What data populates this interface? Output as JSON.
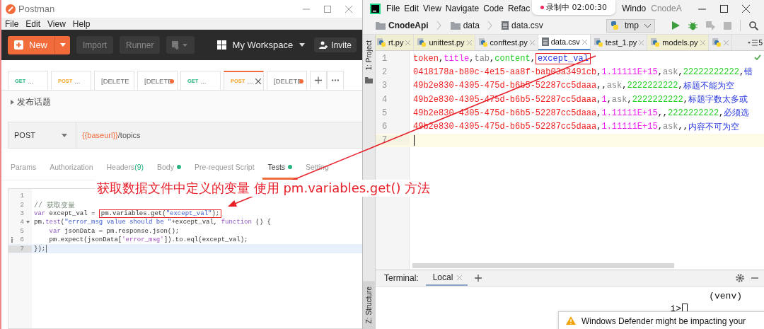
{
  "postman": {
    "title": "Postman",
    "menu": [
      "File",
      "Edit",
      "View",
      "Help"
    ],
    "toolbar": {
      "new_label": "New",
      "import_label": "Import",
      "runner_label": "Runner",
      "workspace": "My Workspace",
      "invite": "Invite"
    },
    "tabs": [
      {
        "method": "GET",
        "kind": "get",
        "label": "...",
        "unsaved": false,
        "selected": false
      },
      {
        "method": "POST",
        "kind": "post",
        "label": "...",
        "unsaved": false,
        "selected": false
      },
      {
        "kind": "plain",
        "label": "[DELETE",
        "unsaved": false,
        "selected": false
      },
      {
        "kind": "plain",
        "label": "[DELETE",
        "unsaved": true,
        "selected": false
      },
      {
        "method": "GET",
        "kind": "get",
        "label": "...",
        "unsaved": false,
        "selected": false
      },
      {
        "method": "POST",
        "kind": "post",
        "label": "...",
        "unsaved": false,
        "selected": true
      },
      {
        "kind": "plain",
        "label": "[DELETE",
        "unsaved": true,
        "selected": false
      }
    ],
    "collection": "发布话题",
    "request": {
      "method": "POST",
      "url_variable": "{{baseurl}}",
      "url_path": "/topics"
    },
    "request_tabs": [
      {
        "label": "Params",
        "dot": false,
        "selected": false
      },
      {
        "label": "Authorization",
        "dot": false,
        "selected": false
      },
      {
        "label": "Headers",
        "count": "(9)",
        "dot": false,
        "selected": false
      },
      {
        "label": "Body",
        "dot": true,
        "selected": false
      },
      {
        "label": "Pre-request Script",
        "dot": false,
        "selected": false
      },
      {
        "label": "Tests",
        "dot": true,
        "selected": true
      },
      {
        "label": "Setting",
        "dot": false,
        "selected": false
      }
    ],
    "code_lines": [
      {
        "number": "1",
        "fold": false,
        "info": false,
        "current": false
      },
      {
        "number": "2",
        "fold": false,
        "info": false,
        "current": false,
        "tokens": [
          {
            "text": "// 获取变量",
            "kind": "comment"
          }
        ]
      },
      {
        "number": "3",
        "fold": false,
        "info": false,
        "current": false,
        "tokens": [
          {
            "text": "var",
            "kind": "keyword"
          },
          {
            "text": " except_val = ",
            "kind": "plain"
          },
          {
            "kind": "box",
            "tokens": [
              {
                "text": "pm.variables.get(",
                "kind": "plain"
              },
              {
                "text": "\"except_val\"",
                "kind": "string"
              },
              {
                "text": ");",
                "kind": "plain"
              }
            ]
          }
        ]
      },
      {
        "number": "4",
        "fold": true,
        "info": false,
        "current": false,
        "tokens": [
          {
            "text": "pm.",
            "kind": "plain"
          },
          {
            "text": "test",
            "kind": "method"
          },
          {
            "text": "(",
            "kind": "plain"
          },
          {
            "text": "\"error_msg value should be \"",
            "kind": "string"
          },
          {
            "text": "+except_val, ",
            "kind": "plain"
          },
          {
            "text": "function",
            "kind": "keyword"
          },
          {
            "text": " () {",
            "kind": "plain"
          }
        ]
      },
      {
        "number": "5",
        "fold": false,
        "info": false,
        "current": false,
        "tokens": [
          {
            "kind": "indent"
          },
          {
            "text": "var",
            "kind": "keyword"
          },
          {
            "text": " jsonData = pm.response.json();",
            "kind": "plain"
          }
        ]
      },
      {
        "number": "6",
        "fold": false,
        "info": true,
        "current": false,
        "tokens": [
          {
            "kind": "indent"
          },
          {
            "text": "pm.expect(jsonData[",
            "kind": "plain"
          },
          {
            "text": "'error_msg'",
            "kind": "string2"
          },
          {
            "text": "]).to.eql(except_val);",
            "kind": "plain"
          }
        ]
      },
      {
        "number": "7",
        "fold": false,
        "info": false,
        "current": true,
        "tokens": [
          {
            "text": "});",
            "kind": "plain"
          }
        ]
      }
    ]
  },
  "pycharm": {
    "menu": [
      "File",
      "Edit",
      "View",
      "Navigate",
      "Code",
      "Refac"
    ],
    "menu_after": [
      "Windo"
    ],
    "project_title": "CnodeA",
    "breadcrumbs": [
      {
        "label": "CnodeApi",
        "kind": "folder"
      },
      {
        "label": "data",
        "kind": "folder"
      },
      {
        "label": "data.csv",
        "kind": "file"
      }
    ],
    "run_config": "tmp",
    "file_tabs": [
      {
        "label": "rt.py",
        "kind": "python",
        "highlighted": true,
        "selected": false
      },
      {
        "label": "unittest.py",
        "kind": "python",
        "highlighted": true,
        "selected": false
      },
      {
        "label": "conftest.py",
        "kind": "python",
        "highlighted": false,
        "selected": false
      },
      {
        "label": "data.csv",
        "kind": "csv",
        "highlighted": false,
        "selected": true
      },
      {
        "label": "test_1.py",
        "kind": "python",
        "highlighted": false,
        "selected": false
      },
      {
        "label": "models.py",
        "kind": "python",
        "highlighted": true,
        "selected": false
      },
      {
        "kind": "python",
        "highlighted": false,
        "selected": false
      }
    ],
    "tab_overflow": "5",
    "side_tool_top": "1: Project",
    "side_tool_bottom": "Z: Structure",
    "csv_lines": [
      {
        "number": "1",
        "current": false,
        "tokens": [
          {
            "text": "token",
            "kind": "c1"
          },
          {
            "text": ",",
            "kind": "sep"
          },
          {
            "text": "title",
            "kind": "c2"
          },
          {
            "text": ",",
            "kind": "sep"
          },
          {
            "text": "tab",
            "kind": "c3"
          },
          {
            "text": ",",
            "kind": "sep"
          },
          {
            "text": "content",
            "kind": "c4"
          },
          {
            "text": ",",
            "kind": "sep"
          },
          {
            "kind": "box",
            "tokens": [
              {
                "text": "except_val",
                "kind": "c5"
              }
            ]
          }
        ]
      },
      {
        "number": "2",
        "current": false,
        "tokens": [
          {
            "text": "0418178a-b80c-4e15-aa8f-bab03a3491cb",
            "kind": "c1"
          },
          {
            "text": ",",
            "kind": "sep"
          },
          {
            "text": "1.11111E+15",
            "kind": "c2"
          },
          {
            "text": ",",
            "kind": "sep"
          },
          {
            "text": "ask",
            "kind": "c3"
          },
          {
            "text": ",",
            "kind": "sep"
          },
          {
            "text": "22222222222",
            "kind": "c4"
          },
          {
            "text": ",",
            "kind": "sep"
          },
          {
            "text": "错",
            "kind": "c5"
          }
        ]
      },
      {
        "number": "3",
        "current": false,
        "tokens": [
          {
            "text": "49b2e830-4305-475d-b6b5-52287cc5daaa",
            "kind": "c1"
          },
          {
            "text": ",,",
            "kind": "sep"
          },
          {
            "text": "ask",
            "kind": "c3"
          },
          {
            "text": ",",
            "kind": "sep"
          },
          {
            "text": "2222222222",
            "kind": "c4"
          },
          {
            "text": ",",
            "kind": "sep"
          },
          {
            "text": "标题不能为空",
            "kind": "c5"
          }
        ]
      },
      {
        "number": "4",
        "current": false,
        "tokens": [
          {
            "text": "49b2e830-4305-475d-b6b5-52287cc5daaa",
            "kind": "c1"
          },
          {
            "text": ",",
            "kind": "sep"
          },
          {
            "text": "1",
            "kind": "c2"
          },
          {
            "text": ",",
            "kind": "sep"
          },
          {
            "text": "ask",
            "kind": "c3"
          },
          {
            "text": ",",
            "kind": "sep"
          },
          {
            "text": "2222222222",
            "kind": "c4"
          },
          {
            "text": ",",
            "kind": "sep"
          },
          {
            "text": "标题字数太多或",
            "kind": "c5"
          }
        ]
      },
      {
        "number": "5",
        "current": false,
        "tokens": [
          {
            "text": "49b2e830-4305-475d-b6b5-52287cc5daaa",
            "kind": "c1"
          },
          {
            "text": ",",
            "kind": "sep"
          },
          {
            "text": "1.11111E+15",
            "kind": "c2"
          },
          {
            "text": ",,",
            "kind": "sep"
          },
          {
            "text": "2222222222",
            "kind": "c4"
          },
          {
            "text": ",",
            "kind": "sep"
          },
          {
            "text": "必须选",
            "kind": "c5"
          }
        ]
      },
      {
        "number": "6",
        "current": false,
        "tokens": [
          {
            "text": "49b2e830-4305-475d-b6b5-52287cc5daaa",
            "kind": "c1"
          },
          {
            "text": ",",
            "kind": "sep"
          },
          {
            "text": "1.11111E+15",
            "kind": "c2"
          },
          {
            "text": ",",
            "kind": "sep"
          },
          {
            "text": "ask",
            "kind": "c3"
          },
          {
            "text": ",,",
            "kind": "sep"
          },
          {
            "text": "内容不可为空",
            "kind": "c5"
          }
        ]
      },
      {
        "number": "7",
        "current": true
      }
    ],
    "terminal": {
      "title": "Terminal:",
      "tabs": [
        {
          "label": "Local",
          "selected": true
        }
      ],
      "lines": [
        "(venv)",
        "i>"
      ]
    }
  },
  "recording": {
    "text": "录制中 02:00:30"
  },
  "annotation": {
    "text": "获取数据文件中定义的变量 使用 pm.variables.get() 方法"
  },
  "notification": {
    "text": "Windows Defender might be impacting your"
  }
}
